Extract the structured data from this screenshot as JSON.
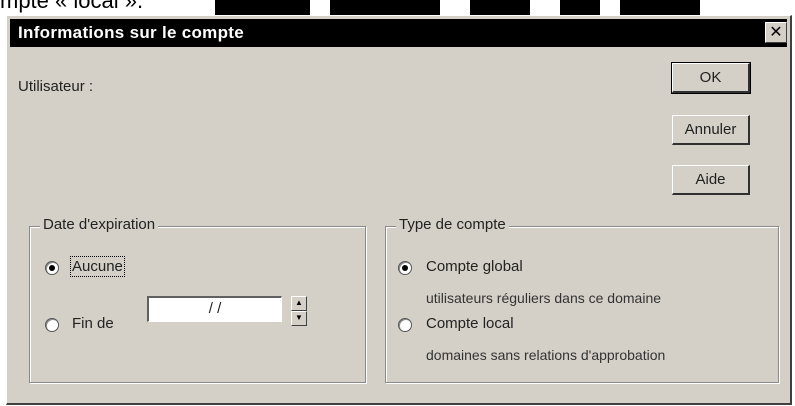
{
  "background": {
    "caption": "mpte « local »."
  },
  "dialog": {
    "title": "Informations sur le compte",
    "close_glyph": "✕",
    "user_label": "Utilisateur :",
    "buttons": {
      "ok": "OK",
      "cancel": "Annuler",
      "help": "Aide"
    },
    "expiration": {
      "legend": "Date d'expiration",
      "none_label": "Aucune",
      "none_selected": true,
      "end_label": "Fin de",
      "end_selected": false,
      "date_value": "/ /"
    },
    "account_type": {
      "legend": "Type de compte",
      "global_label": "Compte global",
      "global_desc": "utilisateurs réguliers dans ce domaine",
      "global_selected": true,
      "local_label": "Compte local",
      "local_desc": "domaines sans relations d'approbation",
      "local_selected": false
    }
  },
  "colors": {
    "face": "#d4d0c8",
    "titlebar": "#000000",
    "window_bg": "#ffffff"
  },
  "icons": [
    "close-icon",
    "spin-up-icon",
    "spin-down-icon",
    "radio-selected-icon",
    "radio-unselected-icon"
  ]
}
